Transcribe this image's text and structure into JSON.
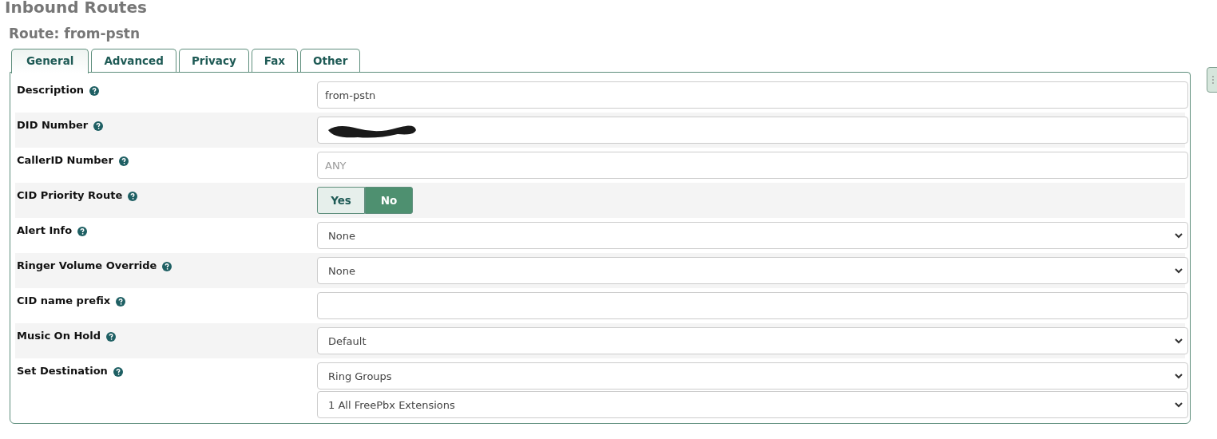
{
  "page_title": "Inbound Routes",
  "route_title": "Route: from-pstn",
  "tabs": [
    {
      "label": "General",
      "selected": true
    },
    {
      "label": "Advanced",
      "selected": false
    },
    {
      "label": "Privacy",
      "selected": false
    },
    {
      "label": "Fax",
      "selected": false
    },
    {
      "label": "Other",
      "selected": false
    }
  ],
  "fields": [
    {
      "kind": "text",
      "label": "Description",
      "value": "from-pstn"
    },
    {
      "kind": "redacted",
      "label": "DID Number"
    },
    {
      "kind": "text",
      "label": "CallerID Number",
      "placeholder": "ANY"
    },
    {
      "kind": "toggle",
      "label": "CID Priority Route",
      "options": [
        {
          "label": "Yes",
          "selected": false
        },
        {
          "label": "No",
          "selected": true
        }
      ]
    },
    {
      "kind": "select",
      "label": "Alert Info",
      "values": [
        "None"
      ]
    },
    {
      "kind": "select",
      "label": "Ringer Volume Override",
      "values": [
        "None"
      ]
    },
    {
      "kind": "text",
      "label": "CID name prefix"
    },
    {
      "kind": "select",
      "label": "Music On Hold",
      "values": [
        "Default"
      ]
    },
    {
      "kind": "select",
      "label": "Set Destination",
      "values": [
        "Ring Groups",
        "1 All FreePbx Extensions"
      ]
    }
  ]
}
